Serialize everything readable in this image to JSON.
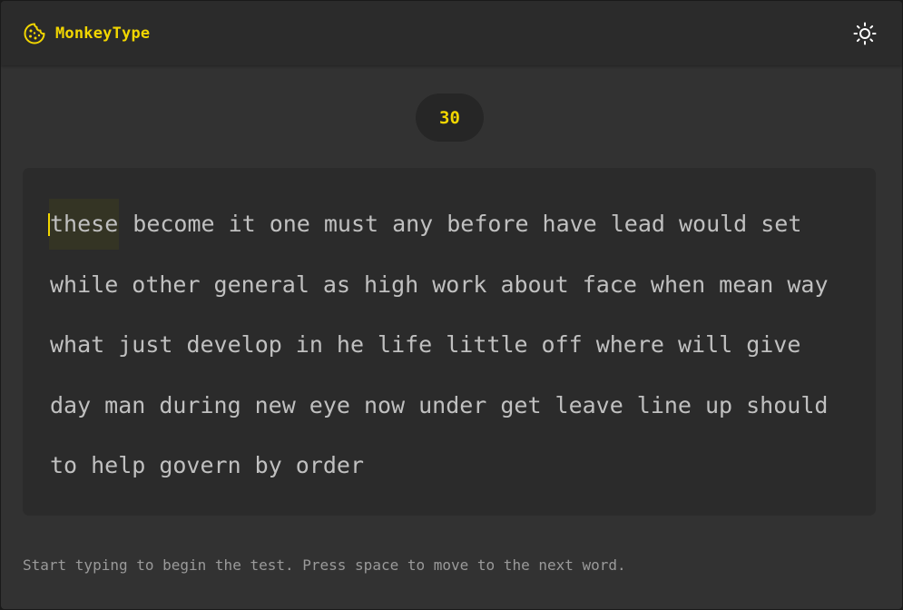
{
  "app": {
    "name": "MonkeyType",
    "logo_icon": "cookie-icon",
    "theme_toggle_icon": "sun-icon",
    "accent_color": "#f2d600"
  },
  "timer": {
    "value": "30"
  },
  "typing": {
    "caret_word_index": 0,
    "lines": [
      [
        "these",
        "become",
        "it",
        "one",
        "must",
        "any",
        "before",
        "have",
        "lead",
        "would",
        "set"
      ],
      [
        "while",
        "other",
        "general",
        "as",
        "high",
        "work",
        "about",
        "face",
        "when",
        "mean",
        "way"
      ],
      [
        "what",
        "just",
        "develop",
        "in",
        "he",
        "life",
        "little",
        "off",
        "where",
        "will",
        "give"
      ],
      [
        "day",
        "man",
        "during",
        "new",
        "eye",
        "now",
        "under",
        "get",
        "leave",
        "line",
        "up",
        "should"
      ],
      [
        "to",
        "help",
        "govern",
        "by",
        "order"
      ]
    ]
  },
  "hint": "Start typing to begin the test. Press space to move to the next word."
}
